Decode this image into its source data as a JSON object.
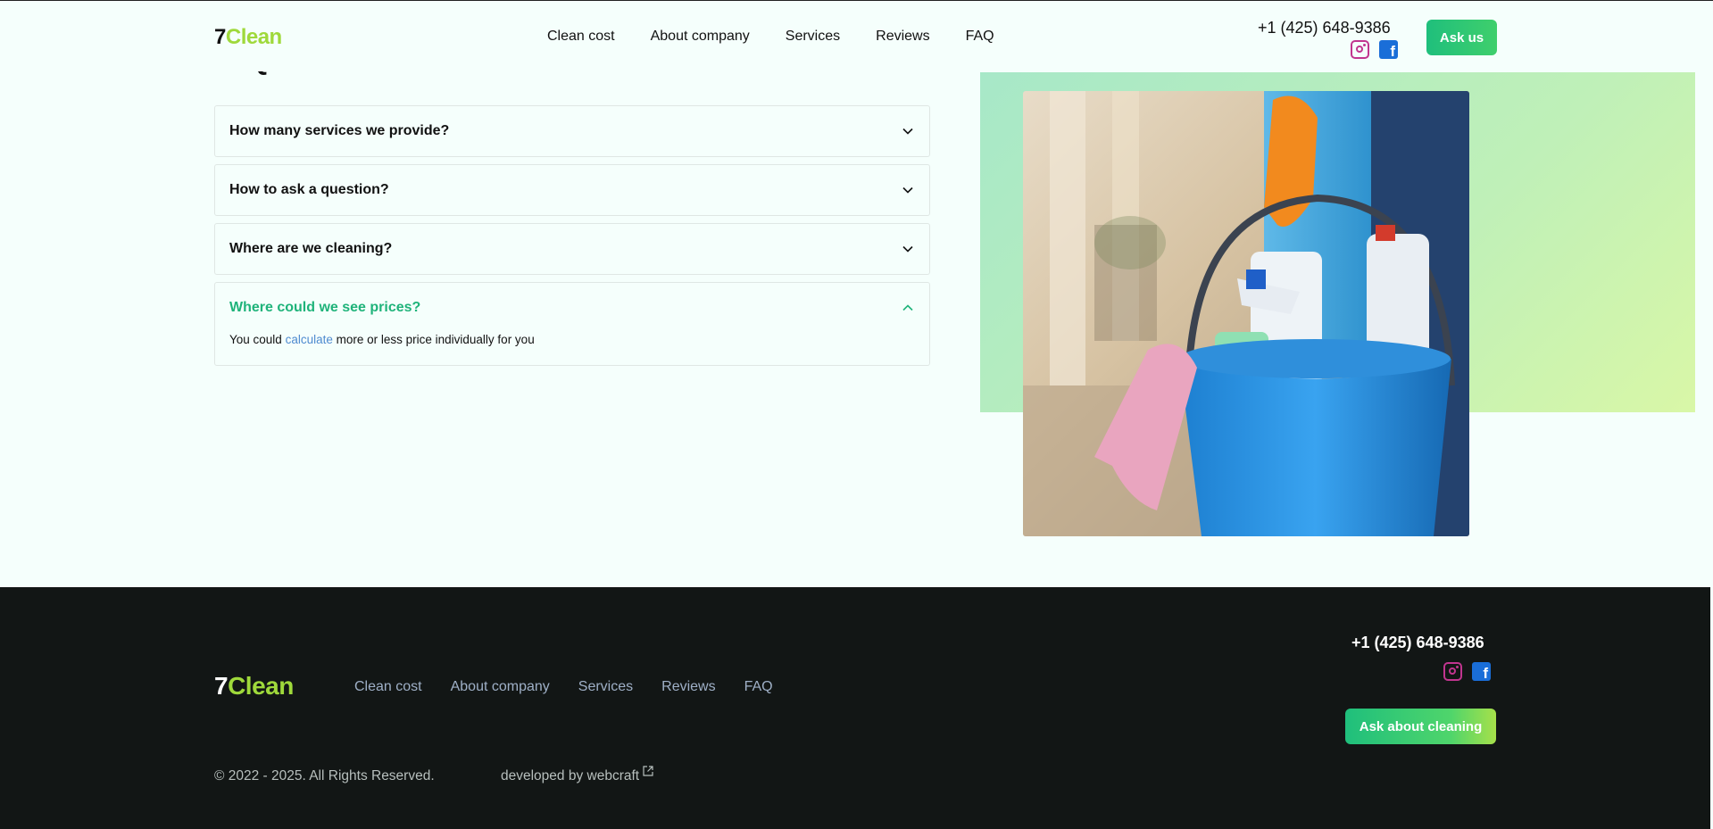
{
  "header": {
    "logo_number": "7",
    "logo_word": "Clean",
    "nav": [
      "Clean cost",
      "About company",
      "Services",
      "Reviews",
      "FAQ"
    ],
    "phone": "+1 (425) 648-9386",
    "ask_button": "Ask us",
    "social": [
      "instagram-icon",
      "facebook-icon"
    ]
  },
  "faq": {
    "title": "FAQ",
    "items": [
      {
        "question": "How many services we provide?",
        "open": false
      },
      {
        "question": "How to ask a question?",
        "open": false
      },
      {
        "question": "Where are we cleaning?",
        "open": false
      },
      {
        "question": "Where could we see prices?",
        "open": true,
        "answer_before": "You could ",
        "answer_link": "calculate",
        "answer_after": " more or less price individually for you"
      }
    ]
  },
  "footer": {
    "logo_number": "7",
    "logo_word": "Clean",
    "nav": [
      "Clean cost",
      "About company",
      "Services",
      "Reviews",
      "FAQ"
    ],
    "phone": "+1 (425) 648-9386",
    "ask_button": "Ask about cleaning",
    "copyright": "© 2022 - 2025. All Rights Reserved.",
    "developed": "developed by webcraft"
  },
  "colors": {
    "accent_green": "#1fb37a",
    "logo_green": "#9fd93b",
    "footer_bg": "#121615",
    "link_blue": "#4f8bd0"
  }
}
